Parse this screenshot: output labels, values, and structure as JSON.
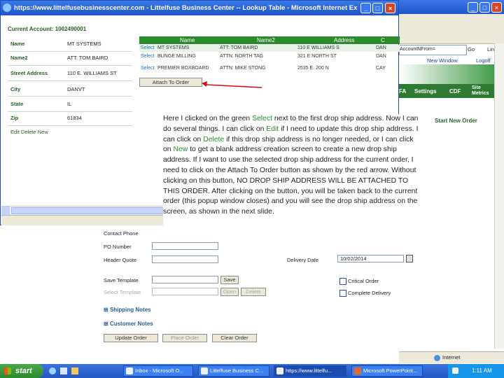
{
  "browser_bg": {
    "address_fragment": "AccountNFrom=",
    "go_label": "Go",
    "links_label": "Link",
    "logoff_label": "Logoff",
    "new_window_label": "New Window",
    "nav_items": [
      "FA",
      "Settings",
      "CDF",
      "Site Metrics"
    ],
    "start_new_order": "Start New Order"
  },
  "popup": {
    "title": "https://www.littelfusebusinesscenter.com - Littelfuse Business Center -- Lookup Table - Microsoft Internet Explo...",
    "current_account_label": "Current Account: 1002490001",
    "fields": [
      {
        "label": "Name",
        "value": "MT SYSTEMS"
      },
      {
        "label": "Name2",
        "value": "ATT: TOM BAIRD"
      },
      {
        "label": "Street Address",
        "value": "110 E. WILLIAMS ST"
      },
      {
        "label": "City",
        "value": "DANVT"
      },
      {
        "label": "State",
        "value": "IL"
      },
      {
        "label": "Zip",
        "value": "61834"
      }
    ],
    "edit_links": "Edit Delete New",
    "table_headers": [
      "Name",
      "Name2",
      "Address",
      "C"
    ],
    "rows": [
      {
        "select": "Select",
        "name": "MT SYSTEMS",
        "name2": "ATT: TOM BAIRD",
        "address": "110 E WILLIAMS S",
        "city": "DAN"
      },
      {
        "select": "Select",
        "name": "BUNGE MILLING",
        "name2": "ATTN: NORTH TAG",
        "address": "321 E NORTH ST",
        "city": "DAN"
      },
      {
        "select": "Select",
        "name": "PREMIER BOXBOARD",
        "name2": "ATTN: MIKE STONG",
        "address": "2535 E. 200 N",
        "city": "CAY"
      }
    ],
    "attach_button": "Attach To Order"
  },
  "tooltip": {
    "t1": "Here I clicked on the green ",
    "select": "Select",
    "t2": " next to the first drop ship address. Now I can do several things. I can click on ",
    "edit": "Edit",
    "t3": " if I need to update this drop ship address. I can click on ",
    "delete": "Delete",
    "t4": " if this drop ship address is no longer needed, or I can click on ",
    "new": "New",
    "t5": " to get a blank address creation screen to create a new drop ship address. If I want to use the selected drop ship address for the current order, I need to click on the Attach To Order button as shown by the red arrow. Without clicking on this button, NO DROP SHIP ADDRESS WILL BE ATTACHED TO THIS ORDER. After clicking on the button, you will be taken back to the current order (this popup window closes) and you will see the drop ship address on the screen, as shown in the next slide."
  },
  "form": {
    "contact_phone": "Contact Phone",
    "po_number": "PO Number",
    "header_quote": "Header Quote",
    "delivery_date_label": "Delivery Date",
    "delivery_date_value": "10/02/2014",
    "save_template": "Save Template",
    "save_btn": "Save",
    "select_template": "Select Template",
    "open_btn": "Open",
    "delete_btn": "Delete",
    "critical_order": "Critical Order",
    "complete_delivery": "Complete Delivery",
    "shipping_notes": "Shipping Notes",
    "customer_notes": "Customer Notes",
    "update_order": "Update Order",
    "place_order": "Place Order",
    "clear_order": "Clear Order"
  },
  "taskbar": {
    "start": "start",
    "tasks": [
      "Inbox - Microsoft O...",
      "Littelfuse Business C...",
      "https://www.littelfu...",
      "Microsoft PowerPoint...",
      "Internet"
    ],
    "clock": "1:11 AM"
  },
  "colors": {
    "accent_green": "#2b8a2b",
    "link_blue": "#1a6fc7",
    "arrow_red": "#cc1111",
    "title_blue": "#1f55c8"
  }
}
